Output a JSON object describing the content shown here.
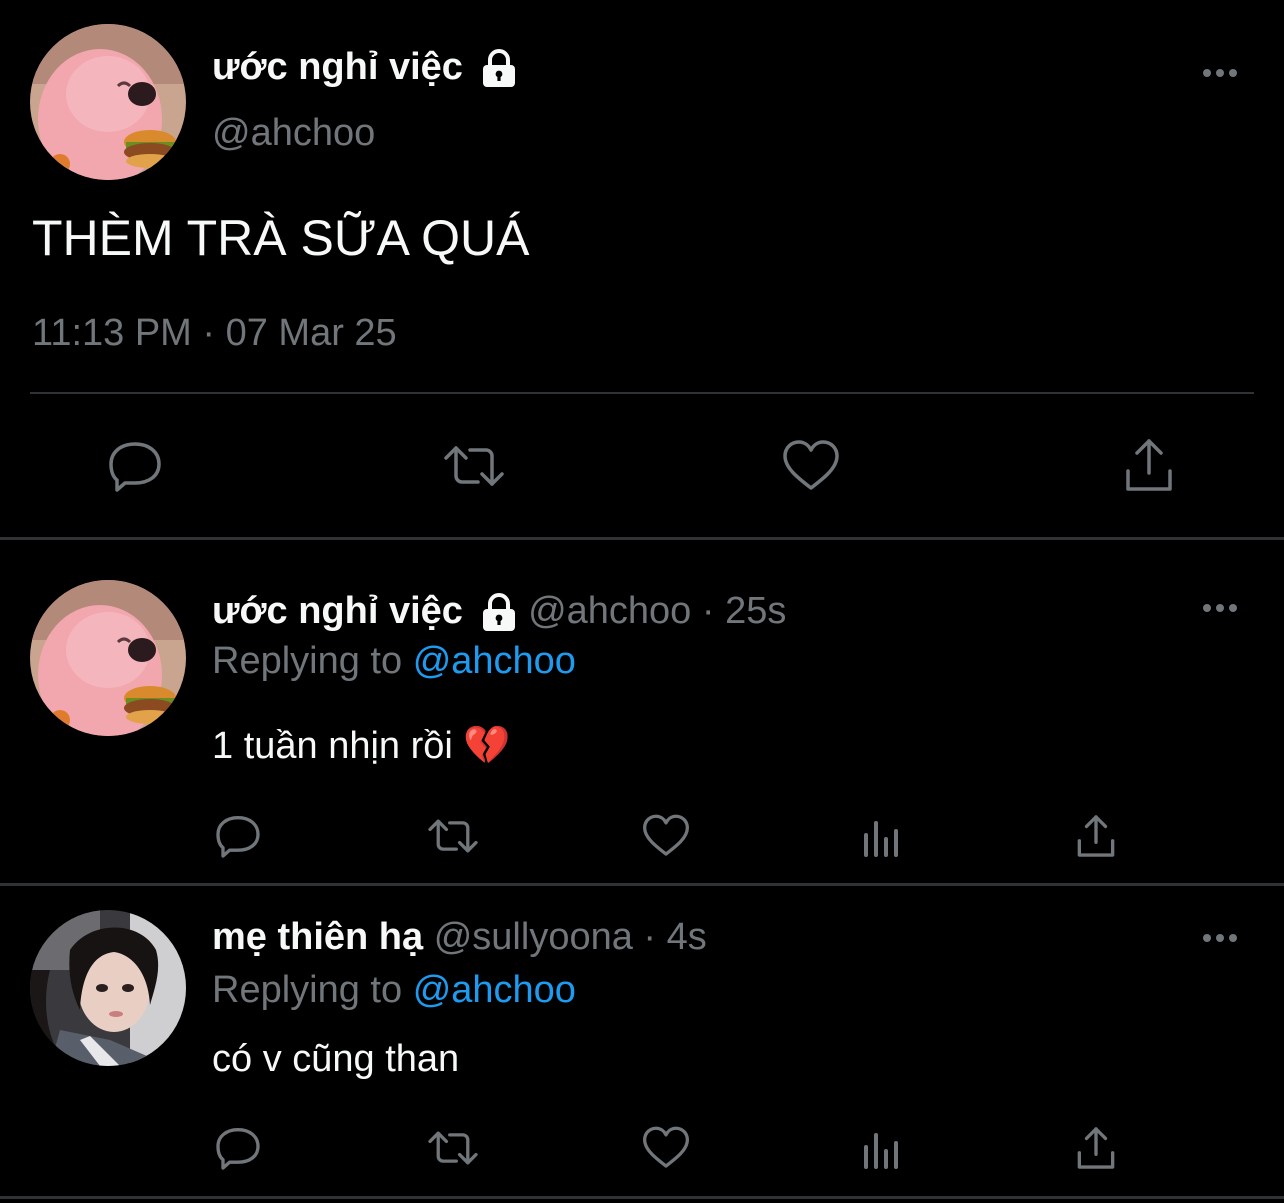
{
  "main_tweet": {
    "display_name": "ước nghỉ việc",
    "handle": "@ahchoo",
    "text": "THÈM TRÀ SỮA QUÁ",
    "timestamp": "11:13 PM · 07 Mar 25",
    "actions": [
      "reply-icon",
      "retweet-icon",
      "like-icon",
      "share-icon"
    ]
  },
  "replies": [
    {
      "display_name": "ước nghỉ việc",
      "handle": "@ahchoo",
      "age": "· 25s",
      "replying_prefix": "Replying to",
      "replying_to": "@ahchoo",
      "text": "1 tuần nhịn rồi",
      "emoji": "💔",
      "avatar": "pink-beaver-avatar"
    },
    {
      "display_name": "mẹ thiên hạ",
      "handle": "@sullyoona",
      "age": "· 4s",
      "replying_prefix": "Replying to",
      "replying_to": "@ahchoo",
      "text": "có v cũng than",
      "avatar": "girl-selfie-avatar"
    }
  ],
  "colors": {
    "background": "#000000",
    "text": "#e7e9ea",
    "muted": "#71767b",
    "link": "#1d9bf0",
    "divider": "#2f3336"
  }
}
